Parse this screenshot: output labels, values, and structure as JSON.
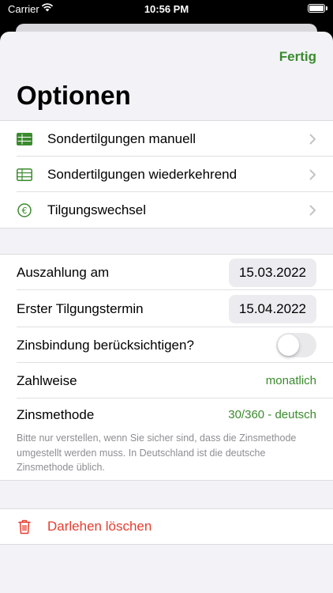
{
  "status": {
    "carrier": "Carrier",
    "time": "10:56 PM"
  },
  "header": {
    "done_label": "Fertig",
    "title": "Optionen"
  },
  "menu": {
    "items": [
      {
        "label": "Sondertilgungen manuell",
        "icon": "table-icon"
      },
      {
        "label": "Sondertilgungen wiederkehrend",
        "icon": "table-outline-icon"
      },
      {
        "label": "Tilgungswechsel",
        "icon": "euro-circle-icon"
      }
    ]
  },
  "settings": {
    "payout_label": "Auszahlung am",
    "payout_date": "15.03.2022",
    "first_repayment_label": "Erster Tilgungstermin",
    "first_repayment_date": "15.04.2022",
    "fixed_interest_label": "Zinsbindung berücksichtigen?",
    "fixed_interest_on": false,
    "payment_label": "Zahlweise",
    "payment_value": "monatlich",
    "method_label": "Zinsmethode",
    "method_value": "30/360 - deutsch",
    "method_note": "Bitte nur verstellen, wenn Sie sicher sind, dass die Zinsmethode umgestellt werden muss. In Deutschland ist die deutsche Zinsmethode üblich."
  },
  "delete": {
    "label": "Darlehen löschen"
  },
  "colors": {
    "accent": "#3b8a2e",
    "destructive": "#e53c2f"
  }
}
